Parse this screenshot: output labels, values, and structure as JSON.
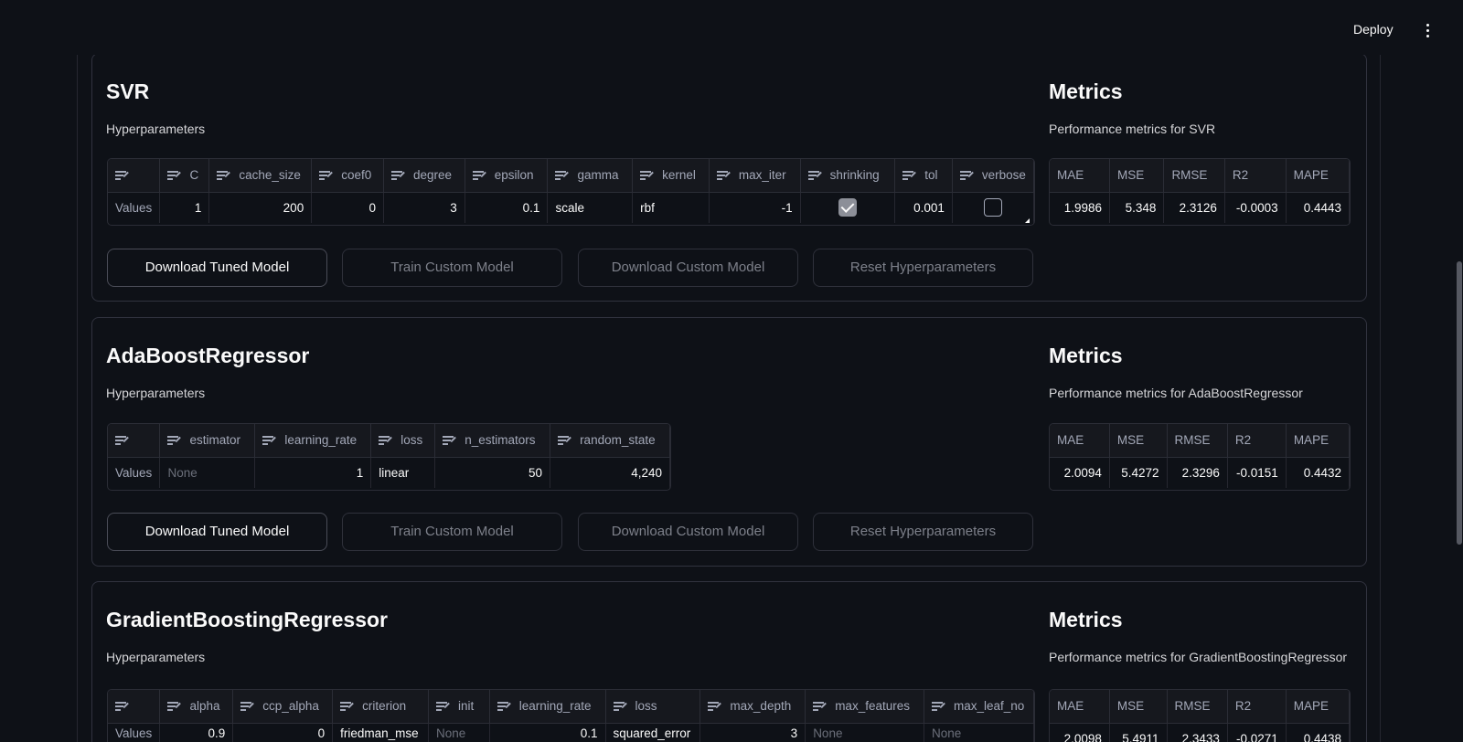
{
  "header": {
    "deploy_label": "Deploy",
    "menu_icon": "kebab-menu-icon"
  },
  "buttons": {
    "download_tuned": "Download Tuned Model",
    "train_custom": "Train Custom Model",
    "download_custom": "Download Custom Model",
    "reset": "Reset Hyperparameters"
  },
  "svr": {
    "title": "SVR",
    "subtitle": "Hyperparameters",
    "metrics_title": "Metrics",
    "metrics_subtitle": "Performance metrics for SVR",
    "columns": [
      "C",
      "cache_size",
      "coef0",
      "degree",
      "epsilon",
      "gamma",
      "kernel",
      "max_iter",
      "shrinking",
      "tol",
      "verbose"
    ],
    "row_label": "Values",
    "values": [
      "1",
      "200",
      "0",
      "3",
      "0.1",
      "scale",
      "rbf",
      "-1",
      "checked",
      "0.001",
      "unchecked"
    ],
    "metric_cols": [
      "MAE",
      "MSE",
      "RMSE",
      "R2",
      "MAPE"
    ],
    "metric_vals": [
      "1.9986",
      "5.348",
      "2.3126",
      "-0.0003",
      "0.4443"
    ]
  },
  "ada": {
    "title": "AdaBoostRegressor",
    "subtitle": "Hyperparameters",
    "metrics_title": "Metrics",
    "metrics_subtitle": "Performance metrics for AdaBoostRegressor",
    "columns": [
      "estimator",
      "learning_rate",
      "loss",
      "n_estimators",
      "random_state"
    ],
    "row_label": "Values",
    "values": [
      "None",
      "1",
      "linear",
      "50",
      "4,240"
    ],
    "metric_cols": [
      "MAE",
      "MSE",
      "RMSE",
      "R2",
      "MAPE"
    ],
    "metric_vals": [
      "2.0094",
      "5.4272",
      "2.3296",
      "-0.0151",
      "0.4432"
    ]
  },
  "gbr": {
    "title": "GradientBoostingRegressor",
    "subtitle": "Hyperparameters",
    "metrics_title": "Metrics",
    "metrics_subtitle": "Performance metrics for GradientBoostingRegressor",
    "columns": [
      "alpha",
      "ccp_alpha",
      "criterion",
      "init",
      "learning_rate",
      "loss",
      "max_depth",
      "max_features",
      "max_leaf_no"
    ],
    "row_label": "Values",
    "values": [
      "0.9",
      "0",
      "friedman_mse",
      "None",
      "0.1",
      "squared_error",
      "3",
      "None",
      "None"
    ],
    "metric_cols": [
      "MAE",
      "MSE",
      "RMSE",
      "R2",
      "MAPE"
    ],
    "metric_vals": [
      "2.0098",
      "5.4911",
      "2.3433",
      "-0.0271",
      "0.4438"
    ]
  }
}
